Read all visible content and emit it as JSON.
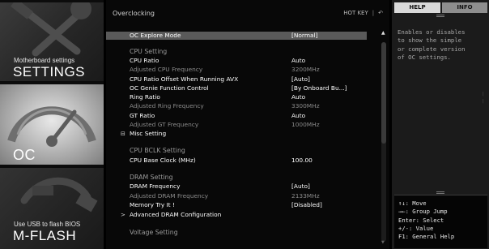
{
  "nav": {
    "settings": {
      "subtitle": "Motherboard settings",
      "title": "SETTINGS",
      "icon": "wrench-hammer-icon"
    },
    "oc": {
      "title": "OC",
      "icon": "speedometer-icon"
    },
    "mflash": {
      "subtitle": "Use USB to flash BIOS",
      "title": "M-FLASH",
      "icon": "usb-plug-icon"
    }
  },
  "header": {
    "title": "Overclocking",
    "hotkey_label": "HOT KEY",
    "hotkey_sep": "|",
    "back_icon": "back-arrow-icon",
    "back_glyph": "↶"
  },
  "rows": [
    {
      "label": "OC Explore Mode",
      "value": "[Normal]",
      "kind": "selected"
    },
    {
      "label": "CPU  Setting",
      "value": "",
      "kind": "header"
    },
    {
      "label": "CPU Ratio",
      "value": "Auto",
      "kind": "item"
    },
    {
      "label": "Adjusted CPU Frequency",
      "value": "3200MHz",
      "kind": "dim"
    },
    {
      "label": "CPU Ratio Offset When Running AVX",
      "value": "[Auto]",
      "kind": "item"
    },
    {
      "label": "OC Genie Function Control",
      "value": "[By Onboard Bu...]",
      "kind": "item"
    },
    {
      "label": "Ring Ratio",
      "value": "Auto",
      "kind": "item"
    },
    {
      "label": "Adjusted Ring Frequency",
      "value": "3300MHz",
      "kind": "dim"
    },
    {
      "label": "GT Ratio",
      "value": "Auto",
      "kind": "item"
    },
    {
      "label": "Adjusted GT Frequency",
      "value": "1000MHz",
      "kind": "dim"
    },
    {
      "label": "Misc Setting",
      "value": "",
      "kind": "collapse",
      "mark": "⊟"
    },
    {
      "label": "CPU  BCLK  Setting",
      "value": "",
      "kind": "header"
    },
    {
      "label": "CPU Base Clock (MHz)",
      "value": "100.00",
      "kind": "item"
    },
    {
      "label": "DRAM  Setting",
      "value": "",
      "kind": "header"
    },
    {
      "label": "DRAM Frequency",
      "value": "[Auto]",
      "kind": "item"
    },
    {
      "label": "Adjusted DRAM Frequency",
      "value": "2133MHz",
      "kind": "dim"
    },
    {
      "label": "Memory Try It !",
      "value": "[Disabled]",
      "kind": "item"
    },
    {
      "label": "Advanced DRAM Configuration",
      "value": "",
      "kind": "submenu",
      "mark": ">"
    },
    {
      "label": "Voltage  Setting",
      "value": "",
      "kind": "header"
    }
  ],
  "scrollbar": {
    "up": "▲",
    "down": "▼"
  },
  "help_panel": {
    "tabs": {
      "help": "HELP",
      "info": "INFO"
    },
    "description": [
      "Enables or disables",
      "to show the simple",
      "or complete version",
      "of OC settings."
    ],
    "keys": [
      "↑↓: Move",
      "→←: Group Jump",
      "Enter: Select",
      "+/-: Value",
      "F1: General Help"
    ]
  },
  "colors": {
    "selected_row": "#5a5a5a",
    "dim_text": "#8a8a8a",
    "help_tab": "#d9d9d9",
    "info_tab": "#8e8e8e"
  }
}
